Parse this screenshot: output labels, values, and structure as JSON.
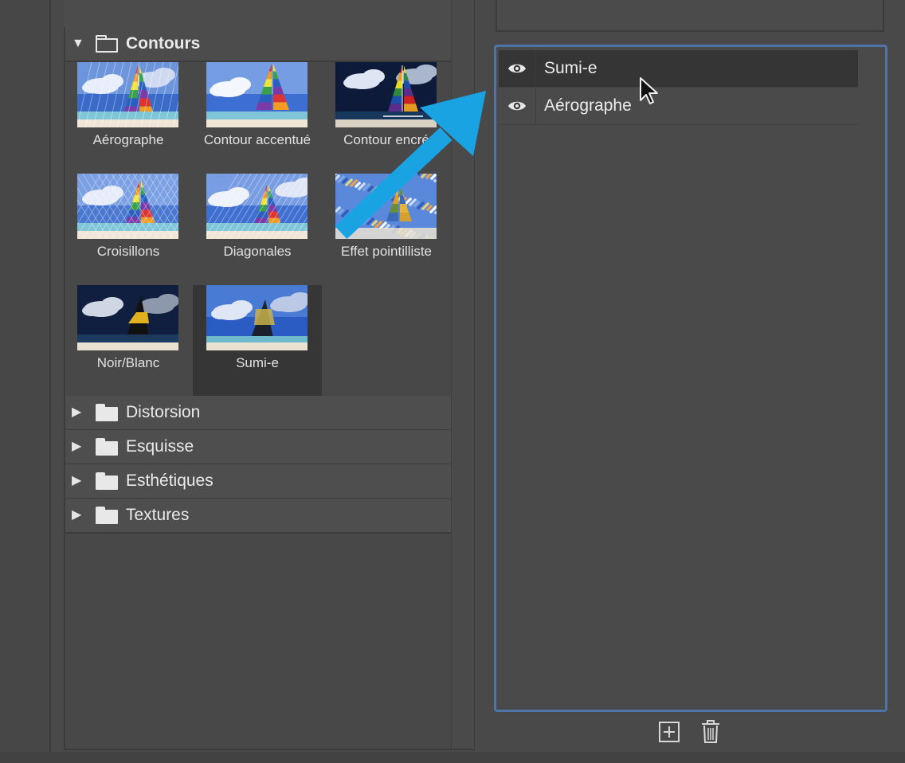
{
  "categories": {
    "open": {
      "label": "Contours"
    },
    "closed": [
      {
        "label": "Distorsion"
      },
      {
        "label": "Esquisse"
      },
      {
        "label": "Esthétiques"
      },
      {
        "label": "Textures"
      }
    ]
  },
  "filters": [
    {
      "label": "Aérographe",
      "selected": false
    },
    {
      "label": "Contour accentué",
      "selected": false
    },
    {
      "label": "Contour encré",
      "selected": false
    },
    {
      "label": "Croisillons",
      "selected": false
    },
    {
      "label": "Diagonales",
      "selected": false
    },
    {
      "label": "Effet pointilliste",
      "selected": false
    },
    {
      "label": "Noir/Blanc",
      "selected": false
    },
    {
      "label": "Sumi-e",
      "selected": true
    }
  ],
  "filter_layers": [
    {
      "name": "Sumi-e",
      "active": true,
      "icon": "eye-icon"
    },
    {
      "name": "Aérographe",
      "active": false,
      "icon": "eye-icon"
    }
  ],
  "layer_actions": {
    "new_icon": "plus-square-icon",
    "delete_icon": "trash-icon"
  },
  "annotation": {
    "arrow_color": "#1aa3e3",
    "arrow_icon": "arrow-icon"
  },
  "colors": {
    "selection_border": "#4f74a8"
  }
}
